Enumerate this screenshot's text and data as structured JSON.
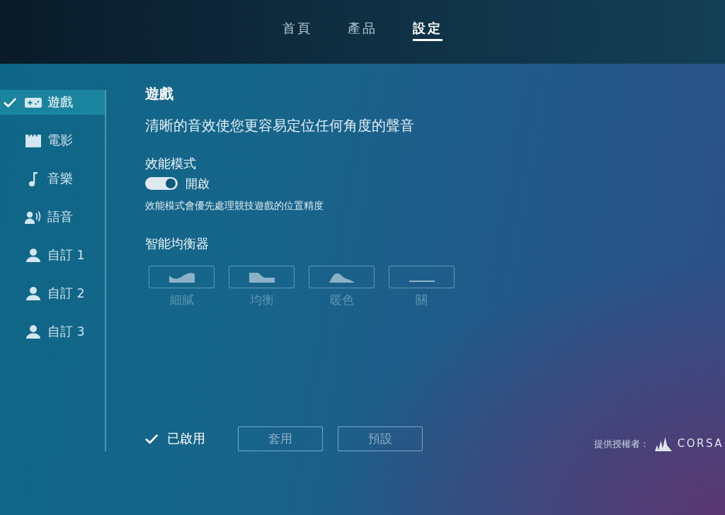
{
  "nav": {
    "tabs": [
      {
        "label": "首頁",
        "selected": false
      },
      {
        "label": "產品",
        "selected": false
      },
      {
        "label": "設定",
        "selected": true
      }
    ]
  },
  "sidebar": {
    "items": [
      {
        "label": "遊戲",
        "kind": "gamepad",
        "selected": true
      },
      {
        "label": "電影",
        "kind": "film",
        "selected": false
      },
      {
        "label": "音樂",
        "kind": "music",
        "selected": false
      },
      {
        "label": "語音",
        "kind": "voice",
        "selected": false
      },
      {
        "label": "自訂 1",
        "kind": "custom",
        "selected": false
      },
      {
        "label": "自訂 2",
        "kind": "custom",
        "selected": false
      },
      {
        "label": "自訂 3",
        "kind": "custom",
        "selected": false
      }
    ]
  },
  "settings": {
    "title": "遊戲",
    "description": "清晰的音效使您更容易定位任何角度的聲音",
    "performance_mode": {
      "label": "效能模式",
      "on": true,
      "state_text": "開啟",
      "hint": "效能模式會優先處理競技遊戲的位置精度"
    },
    "equalizer": {
      "label": "智能均衡器",
      "presets": [
        {
          "label": "細膩",
          "kind": "wave",
          "selected": false
        },
        {
          "label": "均衡",
          "kind": "step",
          "selected": false
        },
        {
          "label": "暖色",
          "kind": "hill",
          "selected": false
        },
        {
          "label": "關",
          "kind": "flat",
          "selected": false
        }
      ]
    }
  },
  "footer": {
    "enabled": {
      "label": "已啟用",
      "checked": true
    },
    "buttons": [
      {
        "label": "套用",
        "disabled": true
      },
      {
        "label": "預設",
        "disabled": true
      }
    ],
    "credit": {
      "label": "提供授權者：",
      "brand": "CORSA"
    }
  }
}
